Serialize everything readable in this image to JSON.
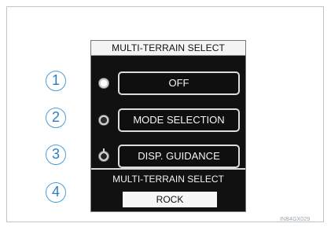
{
  "panel": {
    "title": "MULTI-TERRAIN SELECT",
    "buttons": [
      {
        "label": "OFF",
        "callout": "1",
        "indicator": "lit"
      },
      {
        "label": "MODE SELECTION",
        "callout": "2",
        "indicator": "unlit"
      },
      {
        "label": "DISP. GUIDANCE",
        "callout": "3",
        "indicator": "dial"
      }
    ],
    "info": {
      "label": "MULTI-TERRAIN SELECT",
      "value": "ROCK",
      "callout": "4"
    }
  },
  "figure_code": "INB4GX029",
  "colors": {
    "panel_bg": "#111111",
    "callout": "#2a7fc4",
    "frame": "#bcc4cc"
  }
}
